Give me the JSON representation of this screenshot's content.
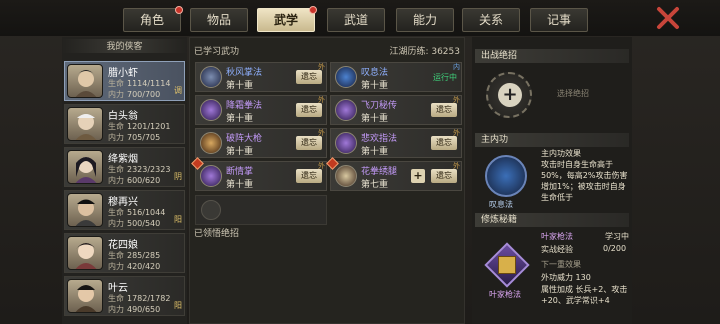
{
  "tabs": [
    {
      "label": "角色",
      "active": false,
      "dot": true
    },
    {
      "label": "物品",
      "active": false,
      "dot": false
    },
    {
      "label": "武学",
      "active": true,
      "dot": true
    },
    {
      "label": "武道",
      "active": false,
      "dot": false
    },
    {
      "label": "能力",
      "active": false,
      "dot": false
    },
    {
      "label": "关系",
      "active": false,
      "dot": false
    },
    {
      "label": "记事",
      "active": false,
      "dot": false
    }
  ],
  "roster": {
    "title": "我的侠客",
    "heroes": [
      {
        "name": "腊小虾",
        "hp": "1114/1114",
        "mp": "700/700",
        "tag": "调",
        "selected": true
      },
      {
        "name": "白头翁",
        "hp": "1201/1201",
        "mp": "705/705",
        "tag": "",
        "selected": false
      },
      {
        "name": "绛紫烟",
        "hp": "2323/2323",
        "mp": "600/620",
        "tag": "阴",
        "selected": false
      },
      {
        "name": "穆再兴",
        "hp": "516/1044",
        "mp": "500/540",
        "tag": "阳",
        "selected": false
      },
      {
        "name": "花四娘",
        "hp": "285/285",
        "mp": "420/420",
        "tag": "",
        "selected": false
      },
      {
        "name": "叶云",
        "hp": "1782/1782",
        "mp": "490/650",
        "tag": "阳",
        "selected": false
      }
    ],
    "hp_label": "生命",
    "mp_label": "内力"
  },
  "mid": {
    "learned_label": "已学习武功",
    "prestige_label": "江湖历练:",
    "prestige_value": "36253",
    "enlightened_label": "已领悟绝招",
    "skills": [
      {
        "name": "秋风掌法",
        "level": "第十重",
        "action": "遗忘",
        "color": "#8fb0ff",
        "corner": "外",
        "warn": false,
        "plus": false
      },
      {
        "name": "叹息法",
        "level": "第十重",
        "action": "运行中",
        "color": "#8fb0ff",
        "corner": "内",
        "warn": false,
        "plus": false,
        "running": true
      },
      {
        "name": "降霜拳法",
        "level": "第十重",
        "action": "遗忘",
        "color": "#c39af8",
        "corner": "外",
        "warn": false,
        "plus": false
      },
      {
        "name": "飞刀秘传",
        "level": "第十重",
        "action": "遗忘",
        "color": "#c39af8",
        "corner": "外",
        "warn": false,
        "plus": false
      },
      {
        "name": "破阵大枪",
        "level": "第十重",
        "action": "遗忘",
        "color": "#c39af8",
        "corner": "外",
        "warn": false,
        "plus": false
      },
      {
        "name": "悲欢指法",
        "level": "第十重",
        "action": "遗忘",
        "color": "#c39af8",
        "corner": "外",
        "warn": false,
        "plus": false
      },
      {
        "name": "断情掌",
        "level": "第十重",
        "action": "遗忘",
        "color": "#c39af8",
        "corner": "外",
        "warn": true,
        "plus": false
      },
      {
        "name": "花拳绣腿",
        "level": "第七重",
        "action": "遗忘",
        "color": "#c39af8",
        "corner": "外",
        "warn": true,
        "plus": true
      }
    ]
  },
  "right": {
    "ult_header": "出战绝招",
    "ult_placeholder": "选择绝招",
    "main_header": "主内功",
    "main_name": "叹息法",
    "main_effect_title": "主内功效果",
    "main_effect": "攻击时自身生命高于50%，每高2%攻击伤害增加1%；被攻击时自身生命低于",
    "cult_header": "修炼秘籍",
    "cult_name": "叶家枪法",
    "cult_book": "叶家枪法",
    "cult_status": "学习中",
    "exp_label": "实战经验",
    "exp_value": "0/200",
    "next_label": "下一重效果",
    "next_line1": "外功威力 130",
    "next_line2": "属性加成   长兵+2、攻击+20、武学常识+4"
  }
}
